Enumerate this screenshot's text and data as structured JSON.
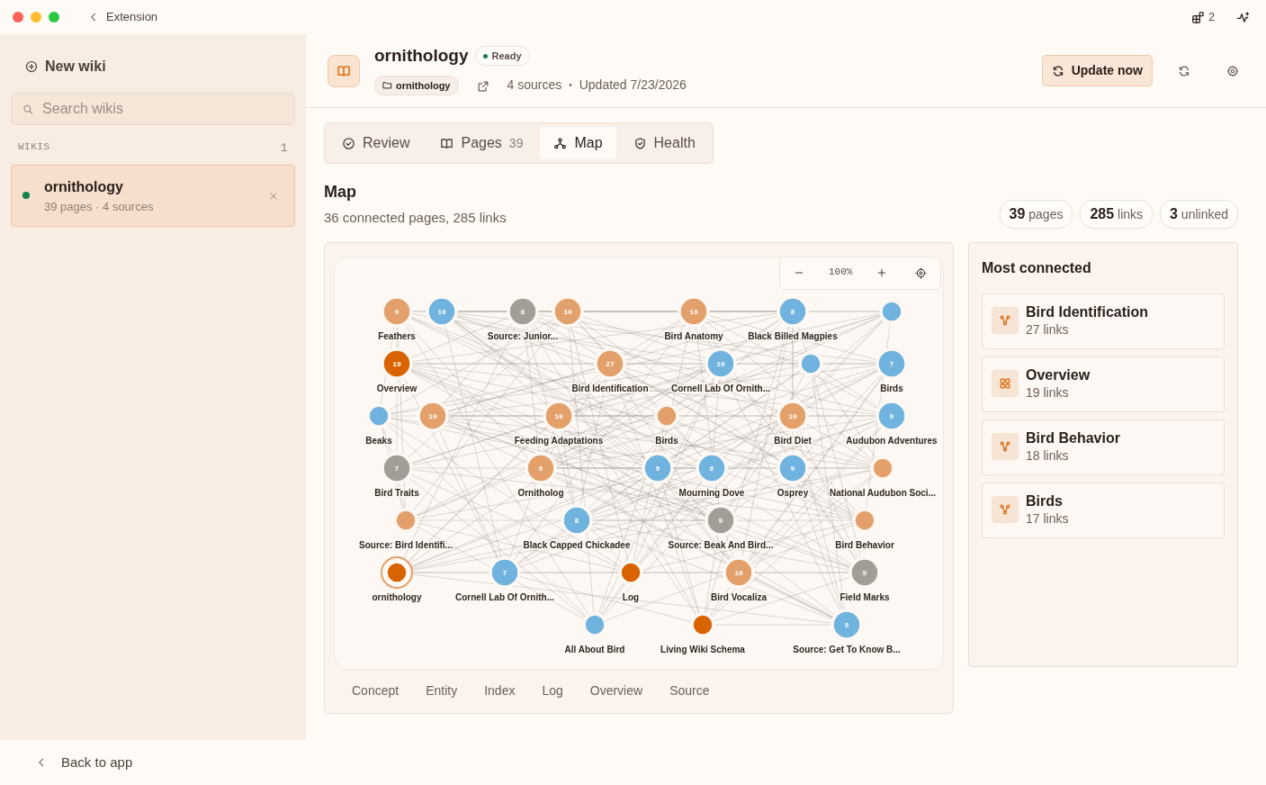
{
  "titlebar": {
    "back_label": "Extension",
    "workspace_count": "2"
  },
  "sidebar": {
    "new_button": "New wiki",
    "search": {
      "placeholder": "Search wikis"
    },
    "section_label": "WIKIS",
    "section_count": "1",
    "wikis": [
      {
        "title": "ornithology",
        "meta": "39 pages · 4 sources",
        "selected": true
      }
    ],
    "back_link": "Back to app"
  },
  "header": {
    "title": "ornithology",
    "status": "Ready",
    "folder": "ornithology",
    "sources": "4 sources",
    "separator": "•",
    "updated": "Updated 7/23/2026",
    "update_button": "Update now"
  },
  "tabs": [
    {
      "label": "Review",
      "kind": "review",
      "selected": false
    },
    {
      "label": "Pages",
      "count": "39",
      "kind": "pages",
      "selected": false
    },
    {
      "label": "Map",
      "kind": "map",
      "selected": true
    },
    {
      "label": "Health",
      "kind": "health",
      "selected": false
    }
  ],
  "map": {
    "title": "Map",
    "subtitle": "36 connected pages, 285 links",
    "stats": [
      {
        "value": "39",
        "unit": "pages"
      },
      {
        "value": "285",
        "unit": "links"
      },
      {
        "value": "3",
        "unit": "unlinked"
      }
    ],
    "zoom": "100%",
    "nodes": [
      {
        "label": "Feathers",
        "count": "9",
        "kind": "concept",
        "selected": false
      },
      {
        "count": "10",
        "kind": "entity",
        "selected": false
      },
      {
        "label": "Source: Junior...",
        "count": "8",
        "kind": "source",
        "selected": false
      },
      {
        "count": "10",
        "kind": "concept",
        "selected": false
      },
      {
        "label": "Bird Anatomy",
        "count": "10",
        "kind": "concept",
        "selected": false
      },
      {
        "label": "Black Billed Magpies",
        "count": "8",
        "kind": "entity",
        "selected": false
      },
      {
        "kind": "entity",
        "selected": false
      },
      {
        "label": "Overview",
        "count": "19",
        "kind": "overview",
        "selected": false
      },
      {
        "label": "Bird Identification",
        "count": "27",
        "kind": "concept",
        "selected": false
      },
      {
        "label": "Cornell Lab Of Ornith...",
        "count": "10",
        "kind": "entity",
        "selected": false
      },
      {
        "kind": "entity",
        "selected": false
      },
      {
        "label": "Birds",
        "count": "7",
        "kind": "entity",
        "selected": false
      },
      {
        "label": "Beaks",
        "kind": "entity",
        "selected": false
      },
      {
        "count": "10",
        "kind": "concept",
        "selected": false
      },
      {
        "label": "Feeding Adaptations",
        "count": "10",
        "kind": "concept",
        "selected": false
      },
      {
        "label": "Birds",
        "kind": "concept",
        "selected": false
      },
      {
        "label": "Bird Diet",
        "count": "10",
        "kind": "concept",
        "selected": false
      },
      {
        "label": "Audubon Adventures",
        "count": "9",
        "kind": "entity",
        "selected": false
      },
      {
        "label": "Bird Traits",
        "count": "7",
        "kind": "source",
        "selected": false
      },
      {
        "label": "Ornitholog",
        "count": "9",
        "kind": "concept",
        "selected": false
      },
      {
        "count": "9",
        "kind": "entity",
        "selected": false
      },
      {
        "label": "Mourning Dove",
        "count": "8",
        "kind": "entity",
        "selected": false
      },
      {
        "label": "Osprey",
        "count": "9",
        "kind": "entity",
        "selected": false
      },
      {
        "label": "National Audubon Soci...",
        "kind": "concept",
        "selected": false
      },
      {
        "label": "Source: Bird Identifi...",
        "kind": "concept",
        "selected": false
      },
      {
        "label": "Black Capped Chickadee",
        "count": "8",
        "kind": "entity",
        "selected": false
      },
      {
        "label": "Source: Beak And Bird...",
        "count": "9",
        "kind": "source",
        "selected": false
      },
      {
        "label": "Bird Behavior",
        "kind": "concept",
        "selected": false
      },
      {
        "label": "ornithology",
        "kind": "index",
        "selected": true
      },
      {
        "label": "Cornell Lab Of Ornith...",
        "count": "7",
        "kind": "entity",
        "selected": false
      },
      {
        "label": "Log",
        "kind": "log",
        "selected": false
      },
      {
        "label": "Bird Vocaliza",
        "count": "10",
        "kind": "concept",
        "selected": false
      },
      {
        "label": "Field Marks",
        "count": "9",
        "kind": "source",
        "selected": false
      },
      {
        "label": "All About Bird",
        "kind": "entity",
        "selected": false
      },
      {
        "label": "Living Wiki Schema",
        "kind": "index",
        "selected": false
      },
      {
        "label": "Source: Get To Know B...",
        "count": "9",
        "kind": "entity",
        "selected": false
      }
    ],
    "legend": [
      "Concept",
      "Entity",
      "Index",
      "Log",
      "Overview",
      "Source"
    ]
  },
  "most_connected": {
    "title": "Most connected",
    "items": [
      {
        "title": "Bird Identification",
        "links": "27 links",
        "kind": "concept"
      },
      {
        "title": "Overview",
        "links": "19 links",
        "kind": "overview"
      },
      {
        "title": "Bird Behavior",
        "links": "18 links",
        "kind": "concept"
      },
      {
        "title": "Birds",
        "links": "17 links",
        "kind": "concept"
      }
    ]
  }
}
